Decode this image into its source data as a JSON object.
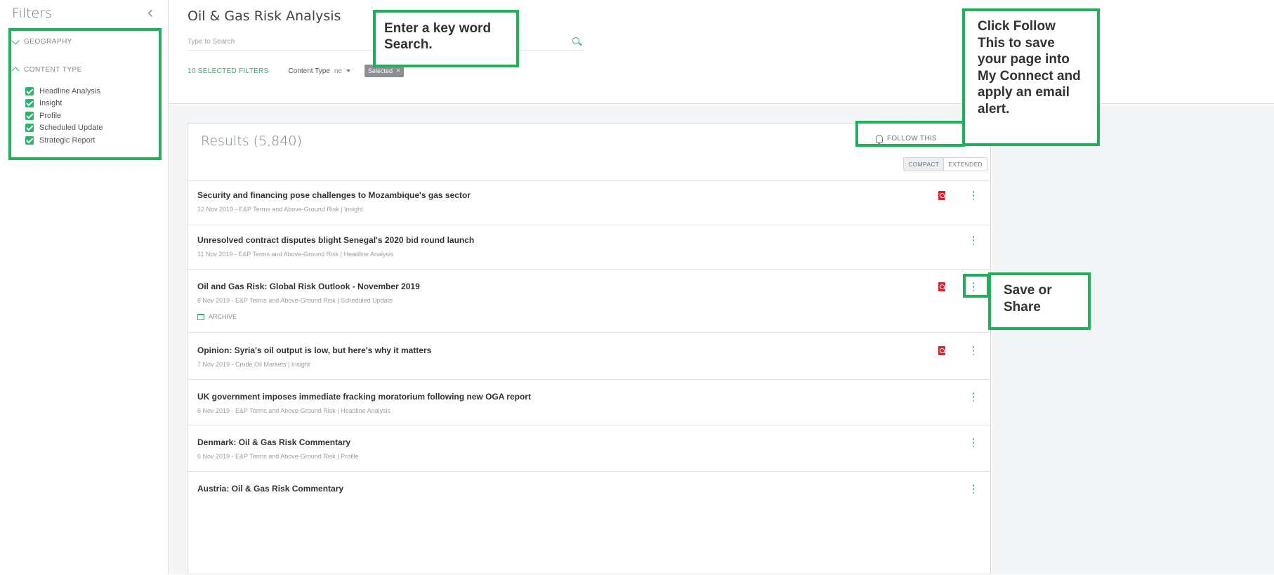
{
  "sidebar": {
    "title": "Filters",
    "sections": [
      {
        "label": "GEOGRAPHY",
        "expanded": false
      },
      {
        "label": "CONTENT TYPE",
        "expanded": true
      }
    ],
    "content_types": [
      "Headline Analysis",
      "Insight",
      "Profile",
      "Scheduled Update",
      "Strategic Report"
    ]
  },
  "header": {
    "title": "Oil & Gas Risk Analysis",
    "search_placeholder": "Type to Search",
    "selected_filters": "10 SELECTED FILTERS",
    "content_type_label": "Content Type",
    "content_type_value": "ne",
    "chip_label": "Selected"
  },
  "results": {
    "title": "Results (5,840)",
    "follow_label": "FOLLOW THIS",
    "view_compact": "COMPACT",
    "view_extended": "EXTENDED",
    "items": [
      {
        "title": "Security and financing pose challenges to Mozambique's gas sector",
        "meta": "12 Nov 2019 - E&P Terms and Above-Ground Risk | Insight",
        "pdf": true
      },
      {
        "title": "Unresolved contract disputes blight Senegal's 2020 bid round launch",
        "meta": "11 Nov 2019 - E&P Terms and Above-Ground Risk | Headline Analysis",
        "pdf": false
      },
      {
        "title": "Oil and Gas Risk: Global Risk Outlook - November 2019",
        "meta": "8 Nov 2019 - E&P Terms and Above-Ground Risk | Scheduled Update",
        "pdf": true,
        "archive": "ARCHIVE"
      },
      {
        "title": "Opinion: Syria's oil output is low, but here's why it matters",
        "meta": "7 Nov 2019 - Crude Oil Markets | Insight",
        "pdf": true
      },
      {
        "title": "UK government imposes immediate fracking moratorium following new OGA report",
        "meta": "6 Nov 2019 - E&P Terms and Above-Ground Risk | Headline Analysis",
        "pdf": false
      },
      {
        "title": "Denmark: Oil & Gas Risk Commentary",
        "meta": "6 Nov 2019 - E&P Terms and Above-Ground Risk | Profile",
        "pdf": false
      },
      {
        "title": "Austria: Oil & Gas Risk Commentary",
        "meta": "",
        "pdf": false
      }
    ]
  },
  "callouts": {
    "search": "Enter a key word Search.",
    "follow": "Click Follow This to save your page into My Connect and apply an email alert.",
    "save_share": "Save or Share"
  },
  "colors": {
    "accent": "#2db36b",
    "callout_border": "#1fb15a",
    "pdf_red": "#d9232d"
  }
}
